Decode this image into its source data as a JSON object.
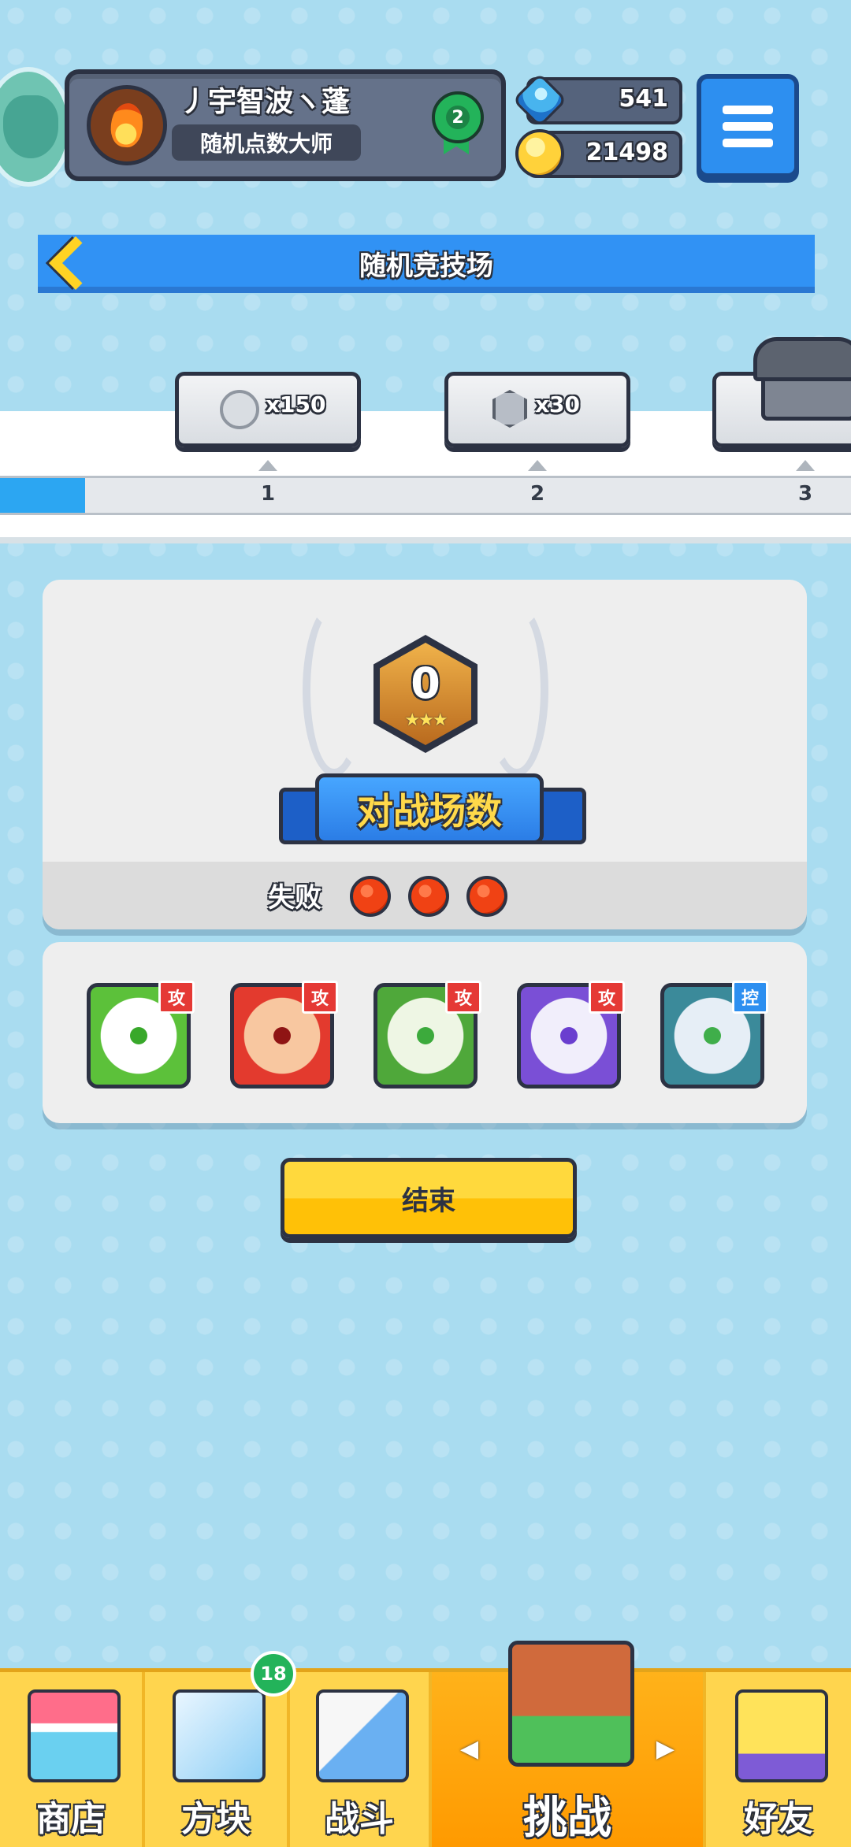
{
  "header": {
    "player_name": "丿宇智波ヽ蓬",
    "player_title": "随机点数大师",
    "rank_level": "2",
    "gems": "541",
    "gold": "21498"
  },
  "title_bar": {
    "title": "随机竞技场"
  },
  "reward_track": {
    "progress_fraction": 0.1,
    "rewards": [
      {
        "icon": "coin-icon",
        "quantity": "x150",
        "step": "1"
      },
      {
        "icon": "gem-icon",
        "quantity": "x30",
        "step": "2"
      },
      {
        "icon": "chest-icon",
        "quantity": "",
        "step": "3"
      }
    ]
  },
  "result": {
    "matches_count": "0",
    "banner_label": "对战场数",
    "loss_label": "失败",
    "losses": 3
  },
  "deck": [
    {
      "tag": "攻",
      "border": "#5cc13a",
      "inner": "#ffffff",
      "pip": "#38a82a",
      "tag_color": "#e53935"
    },
    {
      "tag": "攻",
      "border": "#e33a2e",
      "inner": "#f8c7a0",
      "pip": "#8f1414",
      "tag_color": "#e53935"
    },
    {
      "tag": "攻",
      "border": "#4fa83a",
      "inner": "#eef6e4",
      "pip": "#3caa3c",
      "tag_color": "#e53935"
    },
    {
      "tag": "攻",
      "border": "#7a4fd6",
      "inner": "#f1eefb",
      "pip": "#6a3ecf",
      "tag_color": "#e53935"
    },
    {
      "tag": "控",
      "border": "#3b8a9a",
      "inner": "#e6eef6",
      "pip": "#3fae4a",
      "tag_color": "#2d8ff0"
    }
  ],
  "actions": {
    "end_label": "结束"
  },
  "bottom_nav": {
    "items": [
      {
        "id": "shop",
        "label": "商店"
      },
      {
        "id": "dice",
        "label": "方块",
        "badge": "18"
      },
      {
        "id": "battle",
        "label": "战斗"
      },
      {
        "id": "challenge",
        "label": "挑战",
        "selected": true
      },
      {
        "id": "friends",
        "label": "好友"
      }
    ]
  }
}
